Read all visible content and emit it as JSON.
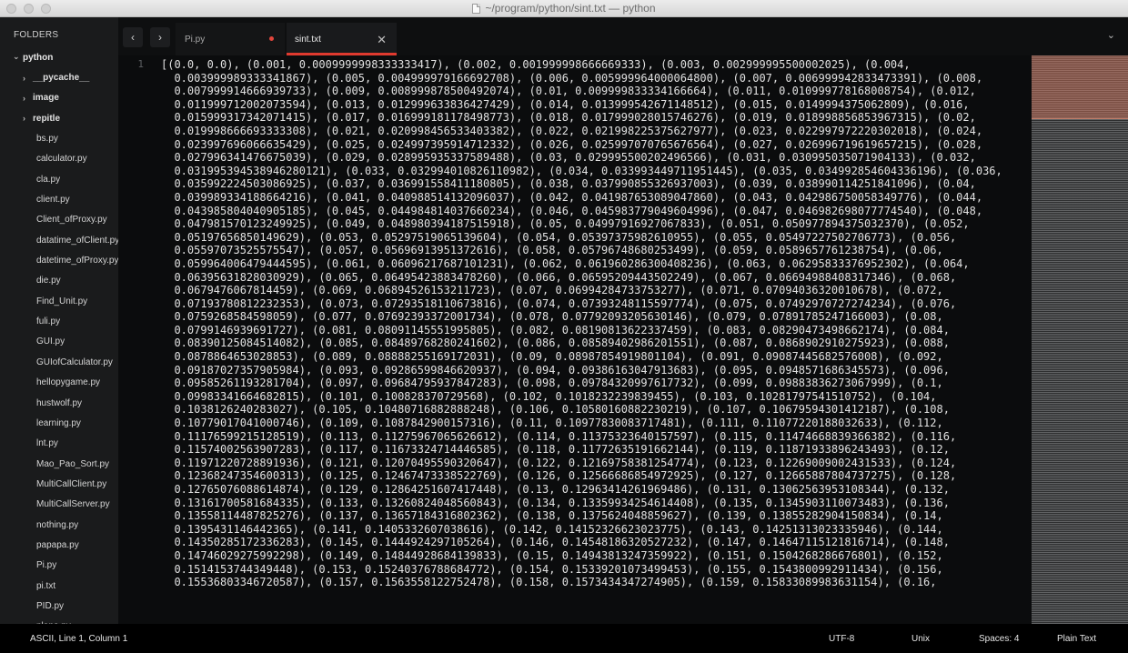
{
  "window": {
    "title": "~/program/python/sint.txt — python"
  },
  "sidebar": {
    "heading": "FOLDERS",
    "root": "python",
    "folders": [
      "__pycache__",
      "image",
      "repitle"
    ],
    "files": [
      "bs.py",
      "calculator.py",
      "cla.py",
      "client.py",
      "Client_ofProxy.py",
      "datatime_ofClient.py",
      "datetime_ofProxy.py",
      "die.py",
      "Find_Unit.py",
      "fuli.py",
      "GUI.py",
      "GUIofCalculator.py",
      "hellopygame.py",
      "hustwolf.py",
      "learning.py",
      "lnt.py",
      "Mao_Pao_Sort.py",
      "MultiCallClient.py",
      "MultiCallServer.py",
      "nothing.py",
      "papapa.py",
      "Pi.py",
      "pi.txt",
      "PID.py",
      "plane.py"
    ]
  },
  "tabs": [
    {
      "label": "Pi.py",
      "dirty": true,
      "active": false
    },
    {
      "label": "sint.txt",
      "dirty": false,
      "active": true
    }
  ],
  "icons": {
    "back": "‹",
    "forward": "›",
    "close": "✕",
    "menu": "⌄",
    "expanded": "⌄",
    "collapsed": "›"
  },
  "editor": {
    "line_number": "1",
    "lines": [
      "[(0.0, 0.0), (0.001, 0.0009999998333333417), (0.002, 0.001999998666669333), (0.003, 0.002999995500002025), (0.004,",
      "  0.003999989333341867), (0.005, 0.004999979166692708), (0.006, 0.005999964000064800), (0.007, 0.006999942833473391), (0.008,",
      "  0.007999914666939733), (0.009, 0.008999878500492074), (0.01, 0.009999833334166664), (0.011, 0.010999778168008754), (0.012,",
      "  0.011999712002073594), (0.013, 0.012999633836427429), (0.014, 0.013999542671148512), (0.015, 0.0149994375062809), (0.016,",
      "  0.015999317342071415), (0.017, 0.016999181178498773), (0.018, 0.017999028015746276), (0.019, 0.018998856853967315), (0.02,",
      "  0.019998666693333308), (0.021, 0.020998456533403382), (0.022, 0.021998225375627977), (0.023, 0.022997972220302018), (0.024,",
      "  0.023997696066635429), (0.025, 0.024997395914712332), (0.026, 0.025997070765676564), (0.027, 0.026996719619657215), (0.028,",
      "  0.027996341476675039), (0.029, 0.028995935337589488), (0.03, 0.029995500202496566), (0.031, 0.030995035071904133), (0.032,",
      "  0.031995394538946280121), (0.033, 0.032994010826110982), (0.034, 0.033993449711951445), (0.035, 0.034992854604336196), (0.036,",
      "  0.035992224503086925), (0.037, 0.036991558411180805), (0.038, 0.037990855326937003), (0.039, 0.038990114251841096), (0.04,",
      "  0.039989334188664216), (0.041, 0.040988514132096037), (0.042, 0.041987653089047860), (0.043, 0.042986750058349776), (0.044,",
      "  0.043985804040905185), (0.045, 0.044984814037660234), (0.046, 0.045983779049604996), (0.047, 0.046982698077774540), (0.048,",
      "  0.047981570123249925), (0.049, 0.048980394187515918), (0.05, 0.04997916927067833), (0.051, 0.050977894375032370), (0.052,",
      "  0.05197656850149629), (0.053, 0.05297519065139604), (0.054, 0.05397375982610955), (0.055, 0.05497227502706773), (0.056,",
      "  0.05597073525575547), (0.057, 0.05696913951372616), (0.058, 0.05796748680253499), (0.059, 0.0589657761238754), (0.06,",
      "  0.059964006479444595), (0.061, 0.06096217687101231), (0.062, 0.061960286300408236), (0.063, 0.06295833376952302), (0.064,",
      "  0.06395631828030929), (0.065, 0.06495423883478260), (0.066, 0.06595209443502249), (0.067, 0.06694988408317346), (0.068,",
      "  0.0679476067814459), (0.069, 0.06894526153211723), (0.07, 0.06994284733753277), (0.071, 0.07094036320010678), (0.072,",
      "  0.07193780812232353), (0.073, 0.07293518110673816), (0.074, 0.07393248115597774), (0.075, 0.07492970727274234), (0.076,",
      "  0.0759268584598059), (0.077, 0.07692393372001734), (0.078, 0.07792093205630146), (0.079, 0.07891785247166003), (0.08,",
      "  0.0799146939691727), (0.081, 0.08091145551995805), (0.082, 0.08190813622337459), (0.083, 0.08290473498662174), (0.084,",
      "  0.08390125084514082), (0.085, 0.08489768280241602), (0.086, 0.08589402986201551), (0.087, 0.0868902910275923), (0.088,",
      "  0.0878864653028853), (0.089, 0.08888255169172031), (0.09, 0.08987854919801104), (0.091, 0.09087445682576008), (0.092,",
      "  0.09187027357905984), (0.093, 0.09286599846620937), (0.094, 0.09386163047913683), (0.095, 0.0948571686345573), (0.096,",
      "  0.09585261193281704), (0.097, 0.09684795937847283), (0.098, 0.09784320997617732), (0.099, 0.09883836273067999), (0.1,",
      "  0.09983341664682815), (0.101, 0.100828370729568), (0.102, 0.1018232239839455), (0.103, 0.10281797541510752), (0.104,",
      "  0.1038126240283027), (0.105, 0.10480716882888248), (0.106, 0.10580160882230219), (0.107, 0.10679594301412187), (0.108,",
      "  0.10779017041000746), (0.109, 0.1087842900157316), (0.11, 0.10977830083717481), (0.111, 0.11077220188032633), (0.112,",
      "  0.11176599215128519), (0.113, 0.11275967065626612), (0.114, 0.11375323640157597), (0.115, 0.11474668839366382), (0.116,",
      "  0.11574002563907283), (0.117, 0.11673324714446585), (0.118, 0.11772635191662144), (0.119, 0.11871933896243493), (0.12,",
      "  0.11971220728891936), (0.121, 0.12070495590320647), (0.122, 0.12169758381254774), (0.123, 0.12269009002431533), (0.124,",
      "  0.12368247354600313), (0.125, 0.12467473338522769), (0.126, 0.12566686854972925), (0.127, 0.12665887804737275), (0.128,",
      "  0.12765076088614874), (0.129, 0.12864251607417448), (0.13, 0.12963414261969486), (0.131, 0.13062563953108344), (0.132,",
      "  0.13161700581684335), (0.133, 0.13260824048560843), (0.134, 0.13359934254614408), (0.135, 0.1345903110073483), (0.136,",
      "  0.13558114487825276), (0.137, 0.13657184316802362), (0.138, 0.1375624048859627), (0.139, 0.13855282904150834), (0.14,",
      "  0.1395431146442365), (0.141, 0.1405332607038616), (0.142, 0.14152326623023775), (0.143, 0.14251313023335946), (0.144,",
      "  0.14350285172336283), (0.145, 0.1444924297105264), (0.146, 0.14548186320527232), (0.147, 0.14647115121816714), (0.148,",
      "  0.14746029275992298), (0.149, 0.14844928684139833), (0.15, 0.14943813247359922), (0.151, 0.1504268286676801), (0.152,",
      "  0.1514153744349448), (0.153, 0.15240376788684772), (0.154, 0.15339201073499453), (0.155, 0.1543800992911434), (0.156,",
      "  0.15536803346720587), (0.157, 0.1563558122752478), (0.158, 0.1573434347274905), (0.159, 0.15833089983631154), (0.16,"
    ]
  },
  "status": {
    "position": "ASCII, Line 1, Column 1",
    "encoding": "UTF-8",
    "line_endings": "Unix",
    "indentation": "Spaces: 4",
    "syntax": "Plain Text"
  },
  "colors": {
    "accent": "#e03a2f",
    "sidebar_bg": "#1a1b1c",
    "editor_bg": "#0b0c0d"
  }
}
